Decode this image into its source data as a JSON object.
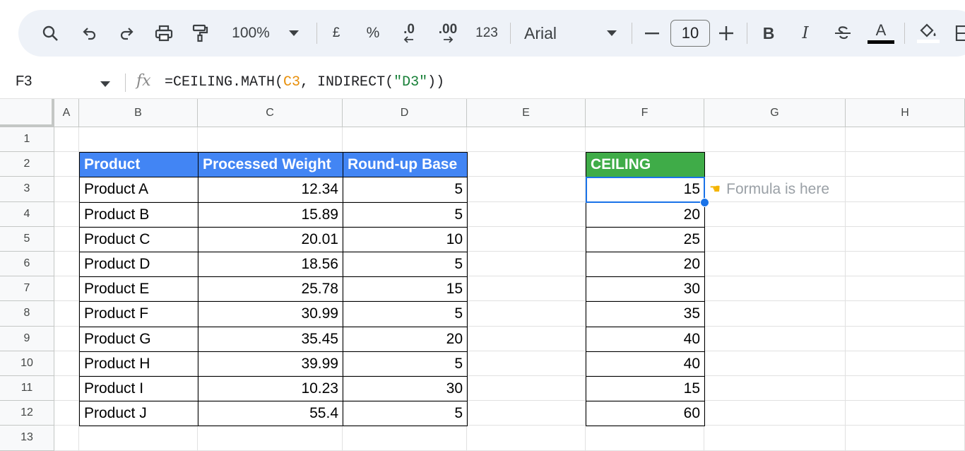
{
  "toolbar": {
    "zoom": "100%",
    "currency": "£",
    "percent": "%",
    "decrease_decimal": ".0",
    "increase_decimal": ".00",
    "number_format": "123",
    "font": "Arial",
    "font_size": "10",
    "bold": "B",
    "italic": "I",
    "text_color": "A"
  },
  "formula_bar": {
    "cell_ref": "F3",
    "fx": "fx",
    "formula_prefix": "=CEILING.MATH(",
    "formula_ref": "C3",
    "formula_mid": ", INDIRECT(",
    "formula_str": "\"D3\"",
    "formula_suffix": "))"
  },
  "columns": [
    "A",
    "B",
    "C",
    "D",
    "E",
    "F",
    "G",
    "H"
  ],
  "rows": [
    "1",
    "2",
    "3",
    "4",
    "5",
    "6",
    "7",
    "8",
    "9",
    "10",
    "11",
    "12",
    "13"
  ],
  "table": {
    "headers": [
      "Product",
      "Processed Weight",
      "Round-up Base"
    ],
    "rows": [
      [
        "Product A",
        "12.34",
        "5"
      ],
      [
        "Product B",
        "15.89",
        "5"
      ],
      [
        "Product C",
        "20.01",
        "10"
      ],
      [
        "Product D",
        "18.56",
        "5"
      ],
      [
        "Product E",
        "25.78",
        "15"
      ],
      [
        "Product F",
        "30.99",
        "5"
      ],
      [
        "Product G",
        "35.45",
        "20"
      ],
      [
        "Product H",
        "39.99",
        "5"
      ],
      [
        "Product I",
        "10.23",
        "30"
      ],
      [
        "Product J",
        "55.4",
        "5"
      ]
    ]
  },
  "ceiling": {
    "header": "CEILING",
    "values": [
      "15",
      "20",
      "25",
      "20",
      "30",
      "35",
      "40",
      "40",
      "15",
      "60"
    ]
  },
  "note": {
    "icon": "pointing-hand-icon",
    "text": "Formula is here"
  },
  "colors": {
    "header_blue": "#4285f4",
    "header_green": "#3fac48",
    "selection": "#1a73e8"
  }
}
